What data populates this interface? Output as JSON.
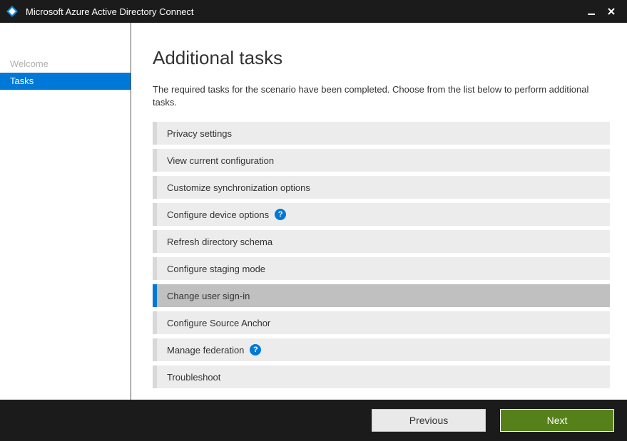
{
  "window": {
    "title": "Microsoft Azure Active Directory Connect"
  },
  "sidebar": {
    "items": [
      {
        "label": "Welcome",
        "active": false
      },
      {
        "label": "Tasks",
        "active": true
      }
    ]
  },
  "main": {
    "title": "Additional tasks",
    "description": "The required tasks for the scenario have been completed. Choose from the list below to perform additional tasks.",
    "tasks": [
      {
        "label": "Privacy settings",
        "help": false,
        "selected": false
      },
      {
        "label": "View current configuration",
        "help": false,
        "selected": false
      },
      {
        "label": "Customize synchronization options",
        "help": false,
        "selected": false
      },
      {
        "label": "Configure device options",
        "help": true,
        "selected": false
      },
      {
        "label": "Refresh directory schema",
        "help": false,
        "selected": false
      },
      {
        "label": "Configure staging mode",
        "help": false,
        "selected": false
      },
      {
        "label": "Change user sign-in",
        "help": false,
        "selected": true
      },
      {
        "label": "Configure Source Anchor",
        "help": false,
        "selected": false
      },
      {
        "label": "Manage federation",
        "help": true,
        "selected": false
      },
      {
        "label": "Troubleshoot",
        "help": false,
        "selected": false
      }
    ]
  },
  "footer": {
    "previous_label": "Previous",
    "next_label": "Next"
  }
}
